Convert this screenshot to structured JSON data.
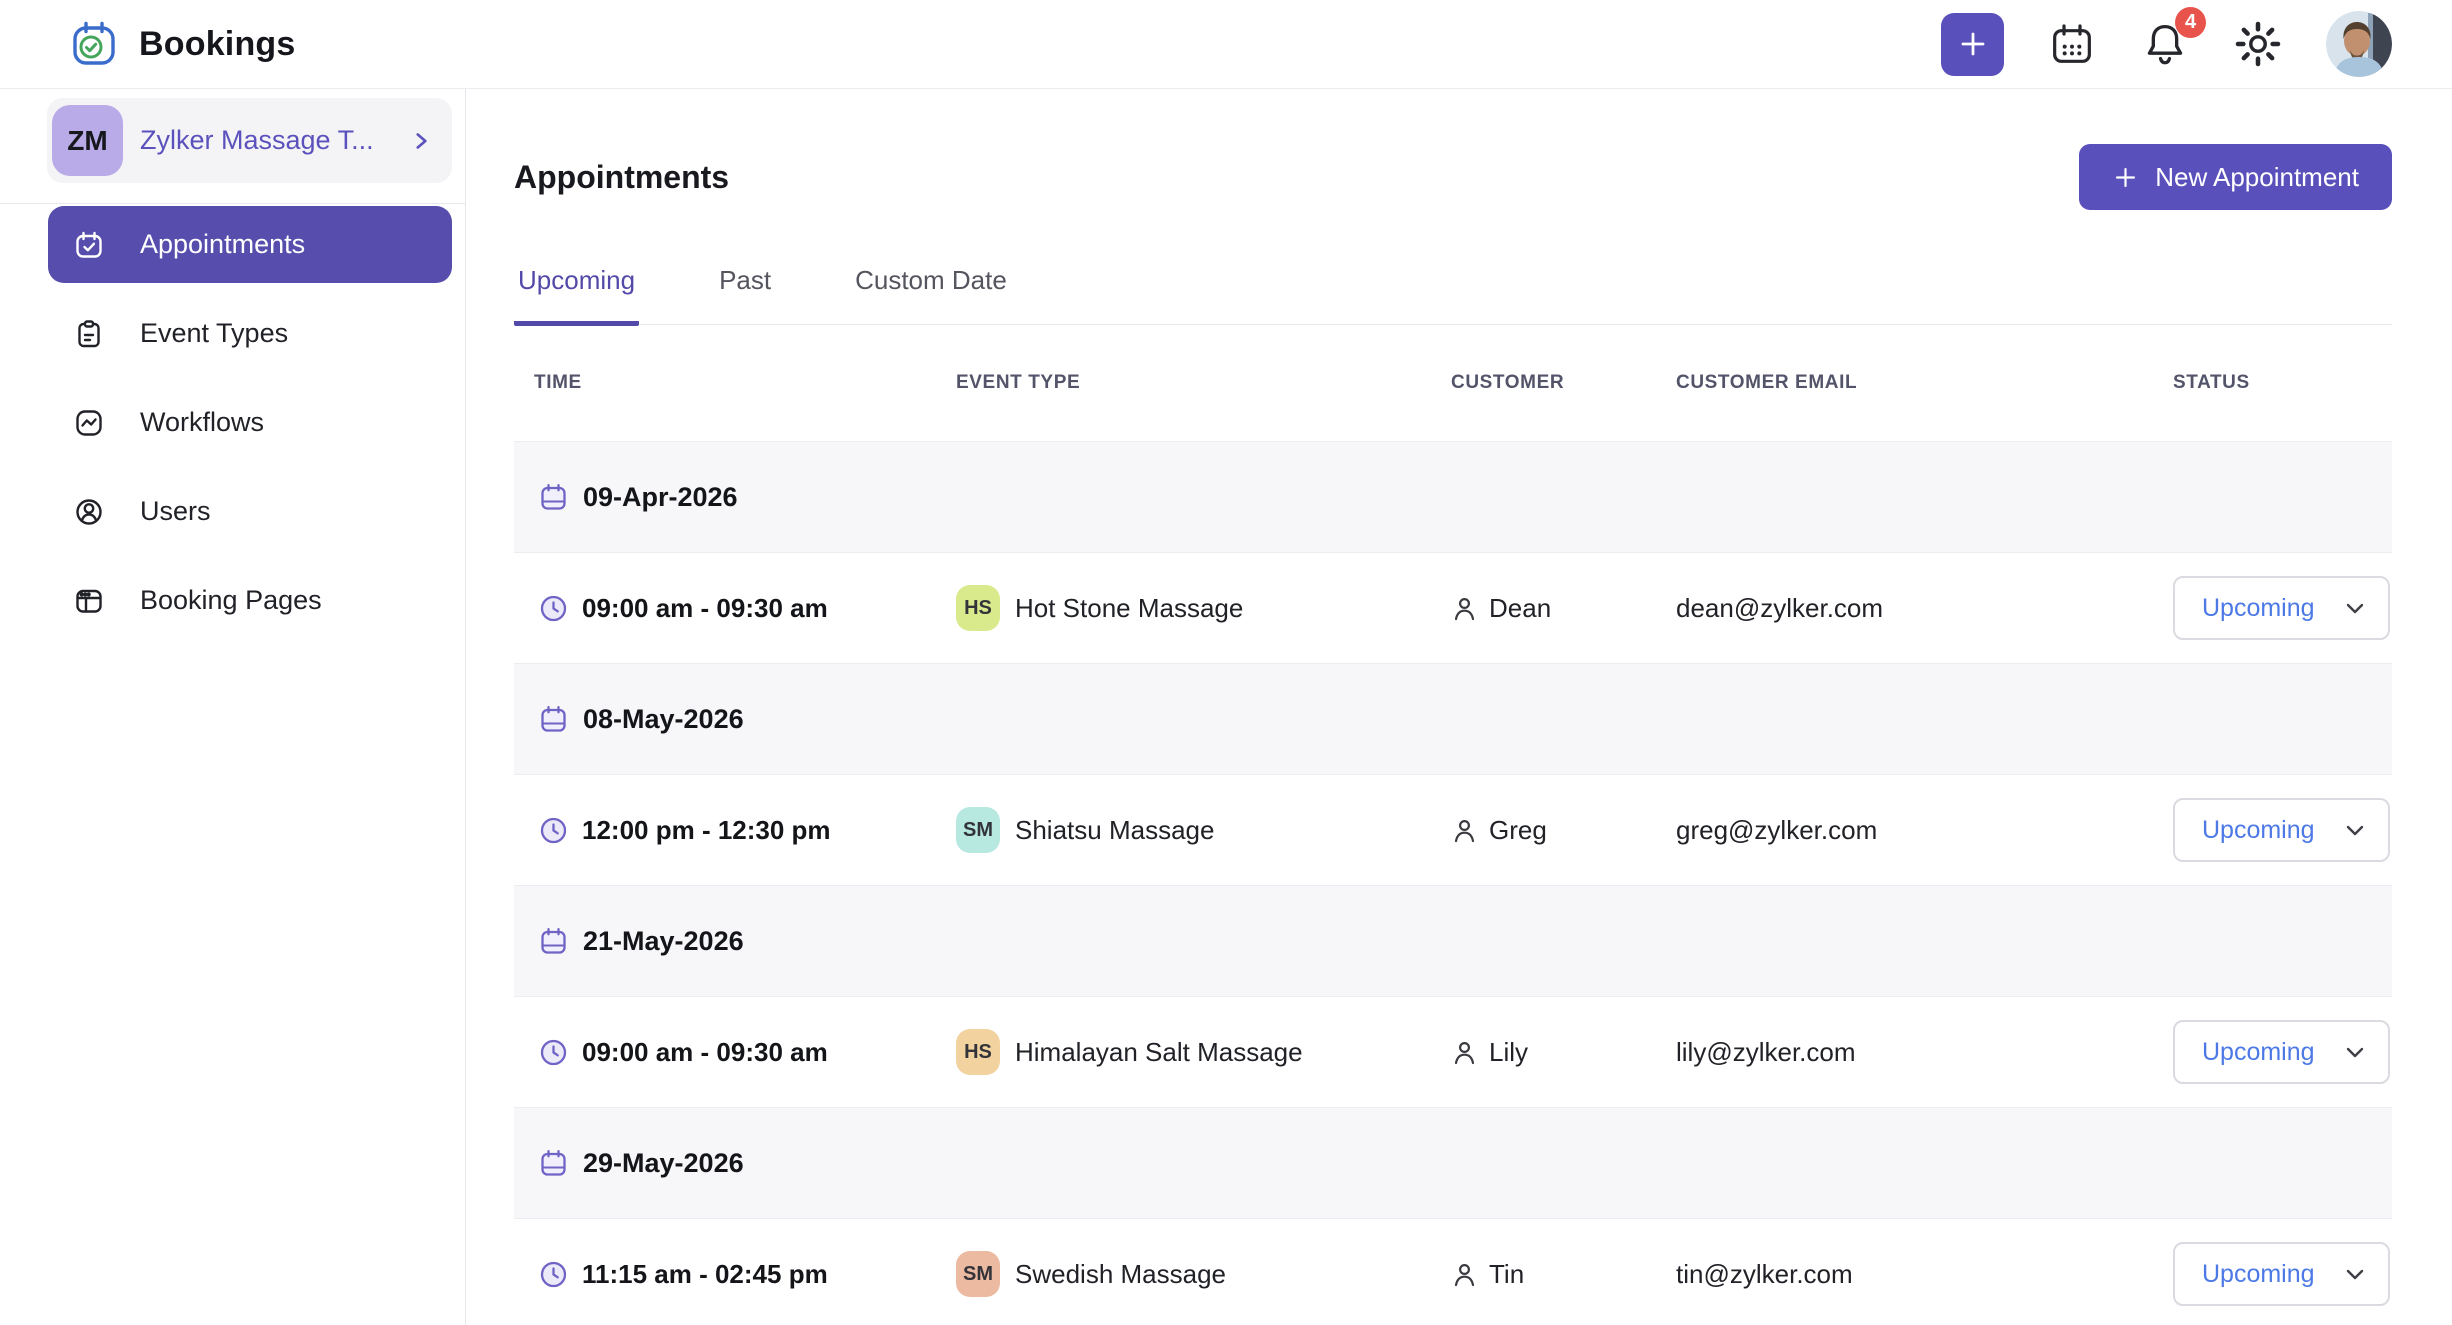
{
  "colors": {
    "accent": "#574DAC",
    "accent_bright": "#5A50BC",
    "status_text": "#4C79E6",
    "notification": "#E8544B",
    "team_chip_bg": "#B9ABE8",
    "logo_blue": "#3A6CCB",
    "logo_green": "#44A55B"
  },
  "header": {
    "app_title": "Bookings",
    "notification_count": "4"
  },
  "sidebar": {
    "team_initials": "ZM",
    "team_name": "Zylker Massage T...",
    "items": [
      {
        "label": "Appointments"
      },
      {
        "label": "Event Types"
      },
      {
        "label": "Workflows"
      },
      {
        "label": "Users"
      },
      {
        "label": "Booking Pages"
      }
    ]
  },
  "main": {
    "title": "Appointments",
    "new_appointment": "New Appointment",
    "tabs": [
      {
        "label": "Upcoming"
      },
      {
        "label": "Past"
      },
      {
        "label": "Custom Date"
      }
    ],
    "columns": {
      "time": "TIME",
      "event": "EVENT TYPE",
      "customer": "CUSTOMER",
      "email": "CUSTOMER EMAIL",
      "status": "STATUS"
    },
    "groups": [
      {
        "date": "09-Apr-2026",
        "rows": [
          {
            "time": "09:00 am - 09:30 am",
            "badge": "HS",
            "badge_color": "#D9EA8D",
            "event": "Hot Stone Massage",
            "customer": "Dean",
            "email": "dean@zylker.com",
            "status": "Upcoming"
          }
        ]
      },
      {
        "date": "08-May-2026",
        "rows": [
          {
            "time": "12:00 pm - 12:30 pm",
            "badge": "SM",
            "badge_color": "#B7E9E1",
            "event": "Shiatsu Massage",
            "customer": "Greg",
            "email": "greg@zylker.com",
            "status": "Upcoming"
          }
        ]
      },
      {
        "date": "21-May-2026",
        "rows": [
          {
            "time": "09:00 am - 09:30 am",
            "badge": "HS",
            "badge_color": "#F2D3A0",
            "event": "Himalayan Salt Massage",
            "customer": "Lily",
            "email": "lily@zylker.com",
            "status": "Upcoming"
          }
        ]
      },
      {
        "date": "29-May-2026",
        "rows": [
          {
            "time": "11:15 am - 02:45 pm",
            "badge": "SM",
            "badge_color": "#ECB9A1",
            "event": "Swedish Massage",
            "customer": "Tin",
            "email": "tin@zylker.com",
            "status": "Upcoming"
          }
        ]
      }
    ]
  }
}
